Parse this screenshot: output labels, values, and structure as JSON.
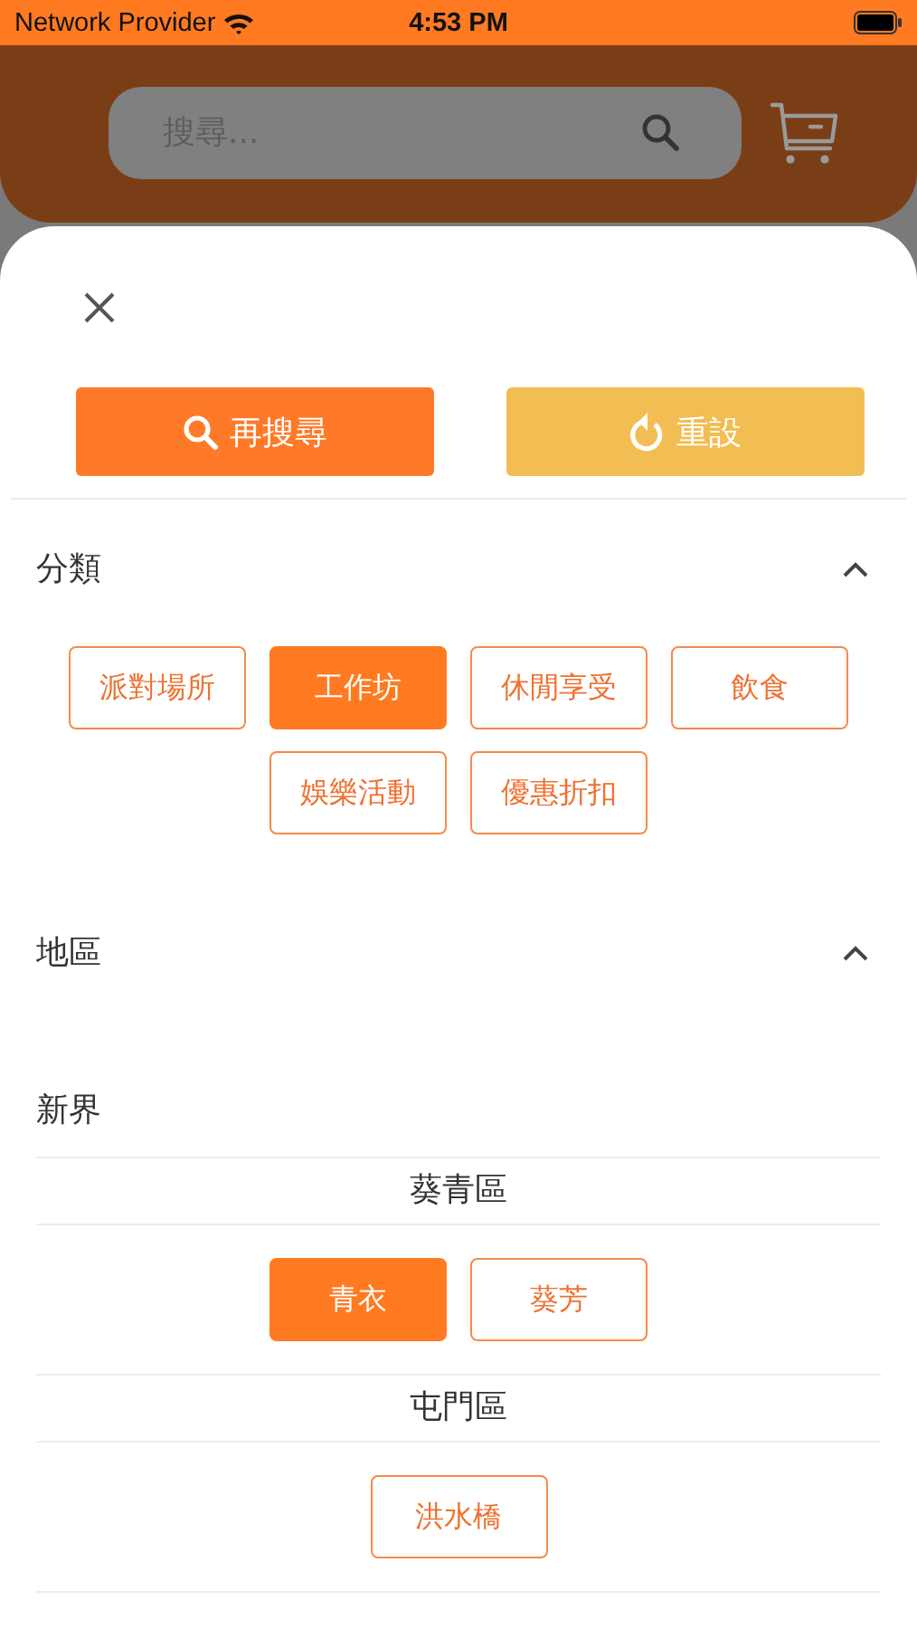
{
  "status_bar": {
    "carrier": "Network Provider",
    "time": "4:53 PM"
  },
  "header": {
    "search": {
      "placeholder": "搜尋..."
    }
  },
  "actions": [
    {
      "kind": "search",
      "label": "再搜尋"
    },
    {
      "kind": "reset",
      "label": "重設"
    }
  ],
  "category": {
    "title": "分類",
    "expanded": true,
    "chips": [
      {
        "label": "派對場所",
        "selected": false
      },
      {
        "label": "工作坊",
        "selected": true
      },
      {
        "label": "休閒享受",
        "selected": false
      },
      {
        "label": "飲食",
        "selected": false
      },
      {
        "label": "娛樂活動",
        "selected": false
      },
      {
        "label": "優惠折扣",
        "selected": false
      }
    ]
  },
  "region": {
    "title": "地區",
    "expanded": true,
    "areas": [
      {
        "name": "新界",
        "districts": [
          {
            "name": "葵青區",
            "chips": [
              {
                "label": "青衣",
                "selected": true
              },
              {
                "label": "葵芳",
                "selected": false
              }
            ]
          },
          {
            "name": "屯門區",
            "chips": [
              {
                "label": "洪水橋",
                "selected": false
              }
            ]
          }
        ]
      }
    ]
  }
}
